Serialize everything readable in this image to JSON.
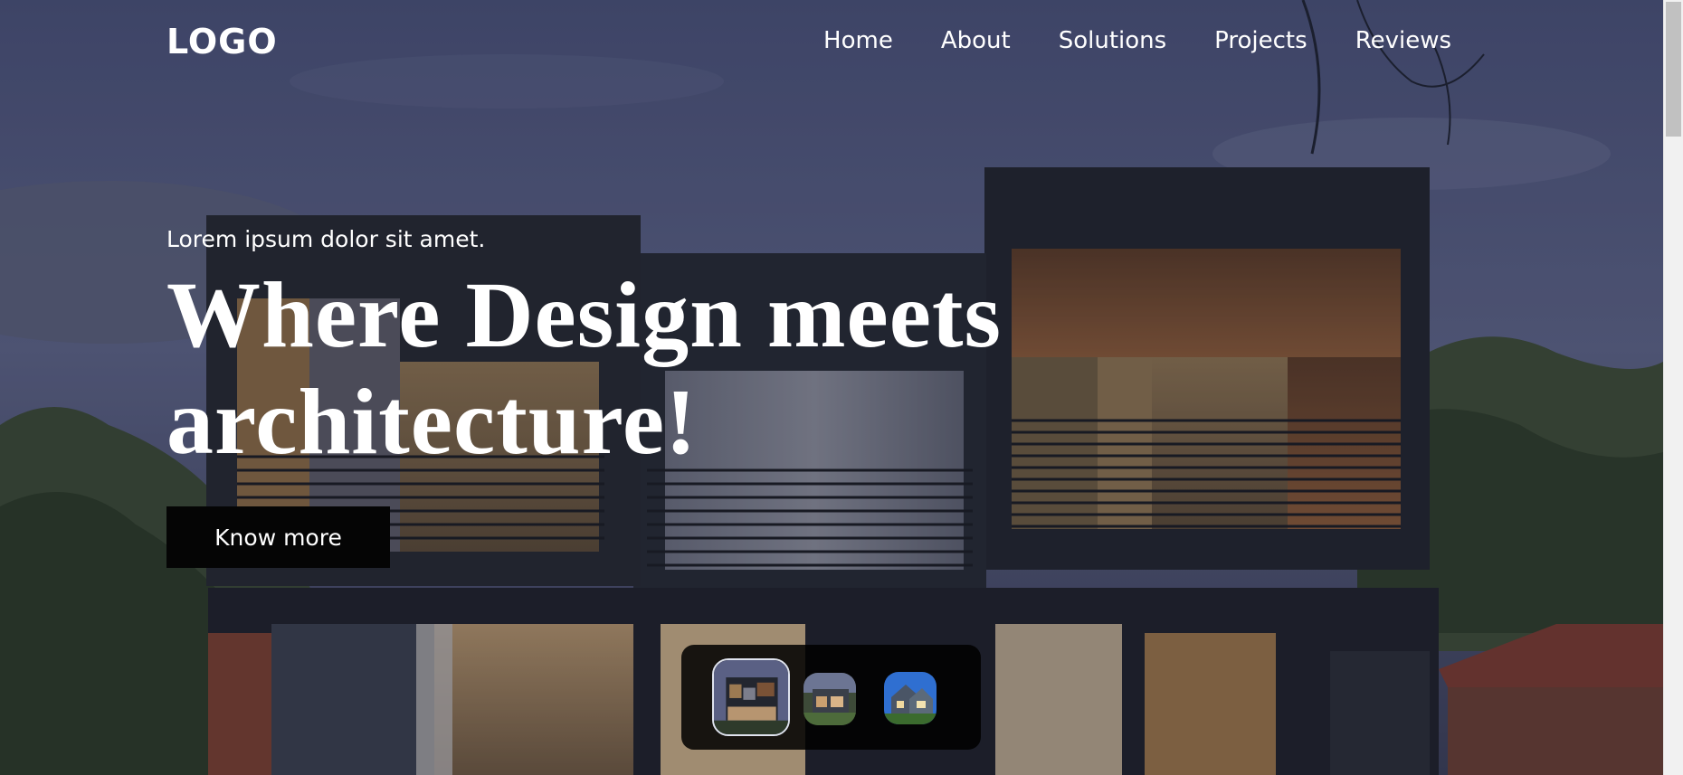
{
  "header": {
    "logo": "LOGO",
    "nav": [
      "Home",
      "About",
      "Solutions",
      "Projects",
      "Reviews"
    ]
  },
  "hero": {
    "kicker": "Lorem ipsum dolor sit amet.",
    "headline_line1": "Where Design meets",
    "headline_line2": "architecture!",
    "cta_label": "Know more",
    "background_image": "modern-two-storey-house-at-dusk",
    "overlay_color": "#1a1f35"
  },
  "gallery": {
    "thumbnails": [
      "house-dusk-thumbnail",
      "house-garden-thumbnail",
      "house-blue-sky-thumbnail"
    ],
    "active_index": 0
  },
  "colors": {
    "text": "#ffffff",
    "button_bg": "#050505",
    "thumb_bar_bg": "#000000"
  }
}
